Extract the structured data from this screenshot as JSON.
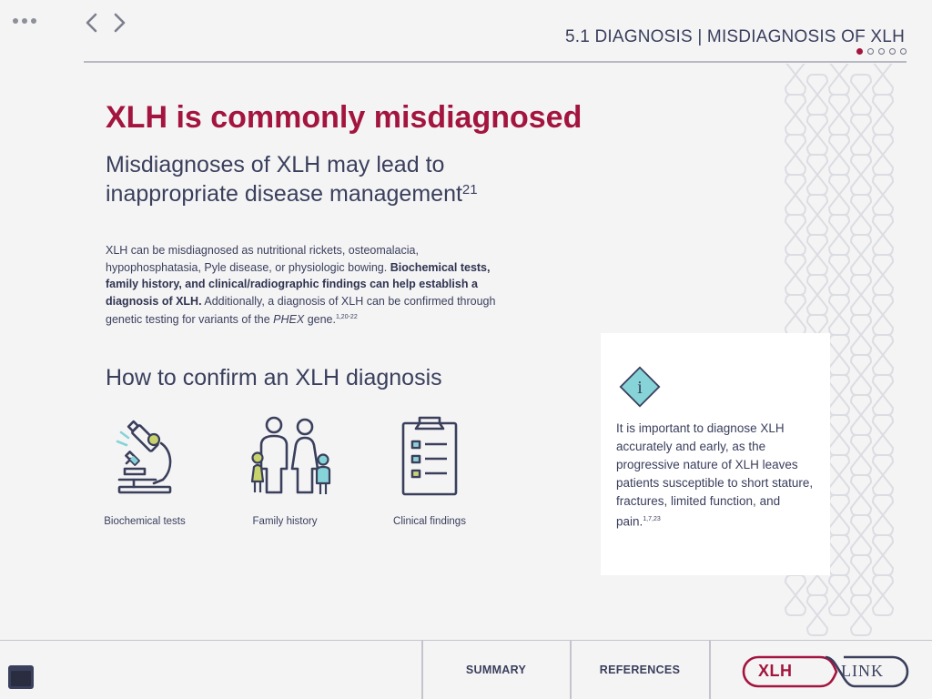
{
  "header": {
    "section_title": "5.1 DIAGNOSIS | MISDIAGNOSIS OF XLH",
    "pager": {
      "total": 5,
      "current": 1
    }
  },
  "main": {
    "headline": "XLH is commonly misdiagnosed",
    "subhead_text": "Misdiagnoses of XLH may lead to inappropriate disease management",
    "subhead_ref": "21",
    "body_intro": "XLH can be misdiagnosed as nutritional rickets, osteomalacia, hypophosphatasia, Pyle disease, or physiologic bowing.",
    "body_bold": "Biochemical tests, family history, and clinical/radiographic findings can help establish a diagnosis of XLH.",
    "body_cont": "Additionally, a diagnosis of XLH can be confirmed through genetic testing for variants of the",
    "body_gene": "PHEX",
    "body_end": "gene.",
    "body_refs": "1,20-22",
    "confirm_heading": "How to confirm an XLH diagnosis",
    "tiles": [
      {
        "label": "Biochemical tests",
        "icon": "microscope-icon"
      },
      {
        "label": "Family history",
        "icon": "family-icon"
      },
      {
        "label": "Clinical findings",
        "icon": "clipboard-checklist-icon"
      }
    ]
  },
  "callout": {
    "icon": "info-icon",
    "text": "It is important to diagnose XLH accurately and early, as the progressive nature of XLH leaves patients susceptible to short stature, fractures, limited function, and pain.",
    "refs": "1,7,23"
  },
  "footer": {
    "summary_label": "SUMMARY",
    "references_label": "REFERENCES",
    "logo_left": "XLH",
    "logo_right": "LINK"
  },
  "colors": {
    "brand": "#a3153f",
    "text": "#3a3f5c",
    "accent_teal": "#86d3d8",
    "accent_lime": "#c9d36b",
    "background": "#f4f4f5"
  }
}
